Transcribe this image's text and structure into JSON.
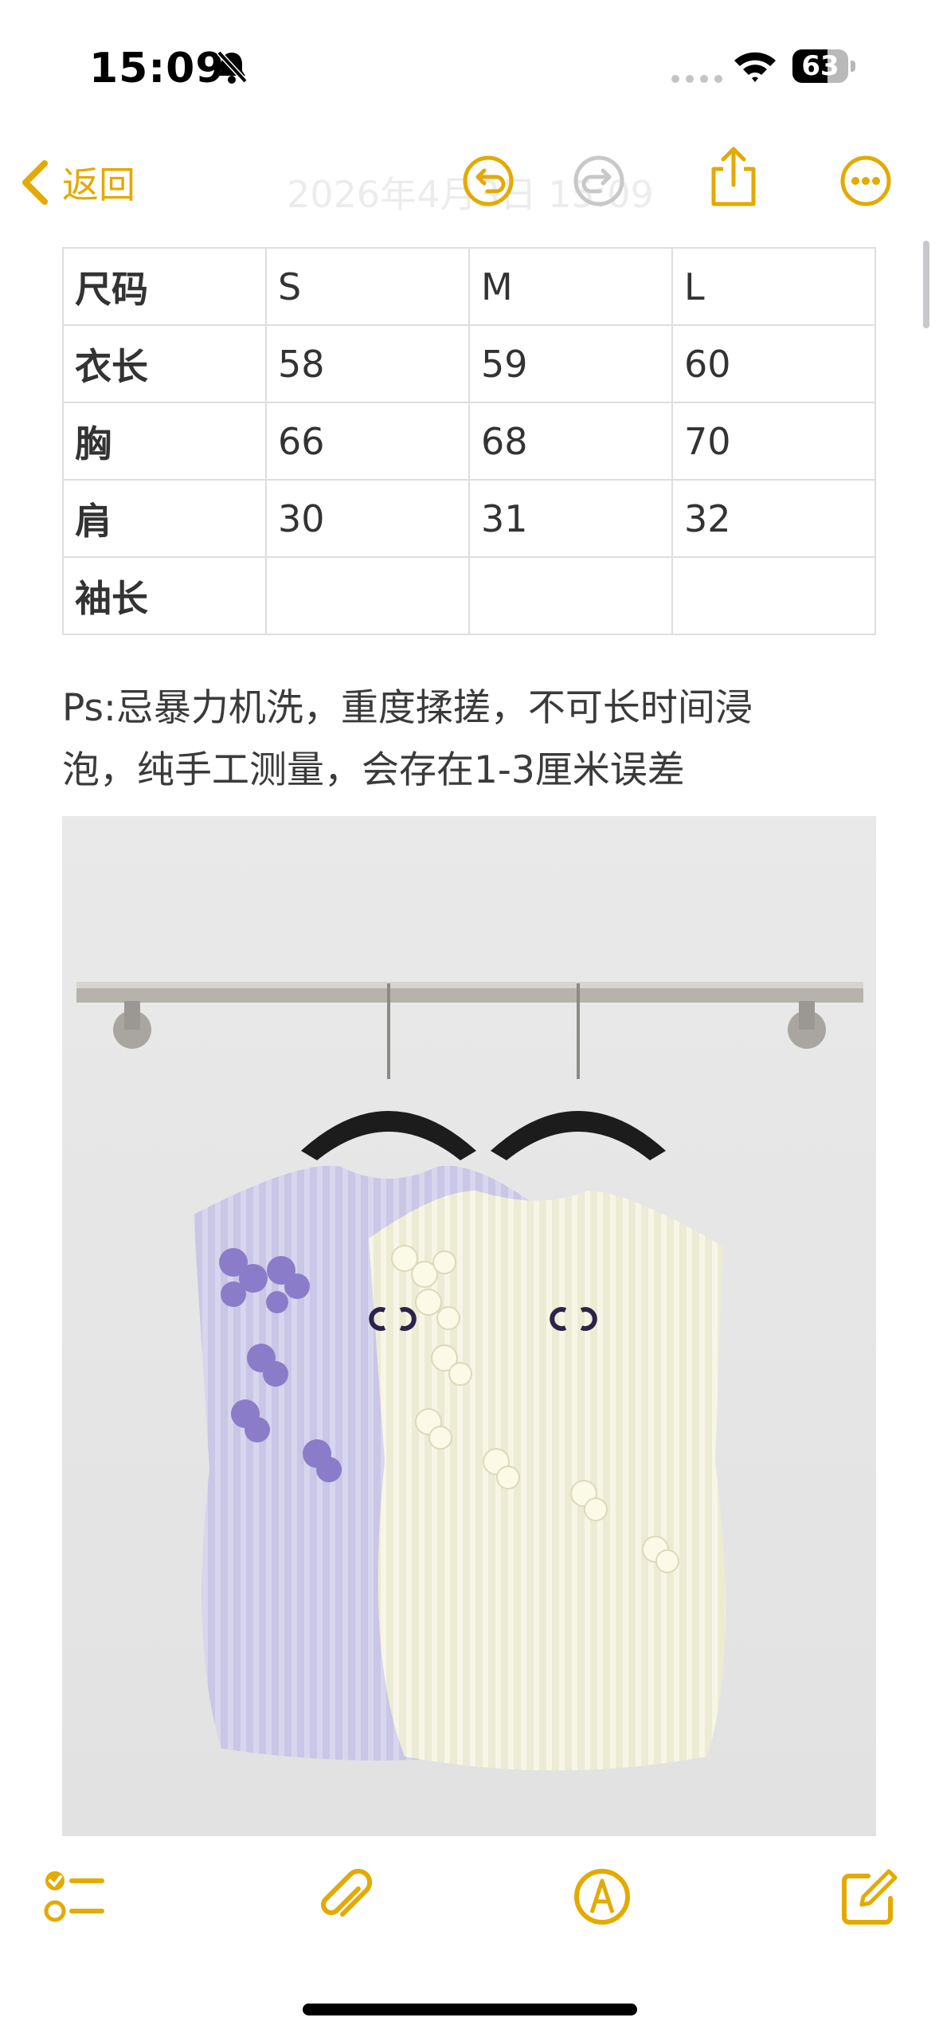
{
  "status_bar": {
    "time": "15:09",
    "battery_level": "63",
    "icons": [
      "bell-slash-icon",
      "cellular-dots-icon",
      "wifi-icon",
      "battery-icon"
    ]
  },
  "nav": {
    "back_label": "返回",
    "ghost_title": "2026年4月3日 15:09",
    "icons": [
      "chevron-left-icon",
      "undo-icon",
      "redo-icon",
      "share-icon",
      "more-icon"
    ],
    "accent": "#e3aa00"
  },
  "size_table": {
    "rows": [
      [
        "尺码",
        "S",
        "M",
        "L"
      ],
      [
        "衣长",
        "58",
        "59",
        "60"
      ],
      [
        "胸",
        "66",
        "68",
        "70"
      ],
      [
        "肩",
        "30",
        "31",
        "32"
      ],
      [
        "袖长",
        "",
        "",
        ""
      ]
    ]
  },
  "note": {
    "line1": "Ps:忌暴力机洗，重度揉搓，不可长时间浸",
    "line2": "泡，纯手工测量，会存在1-3厘米误差"
  },
  "toolbar": {
    "icons": [
      "checklist-icon",
      "paperclip-icon",
      "markup-pen-icon",
      "compose-icon"
    ]
  }
}
